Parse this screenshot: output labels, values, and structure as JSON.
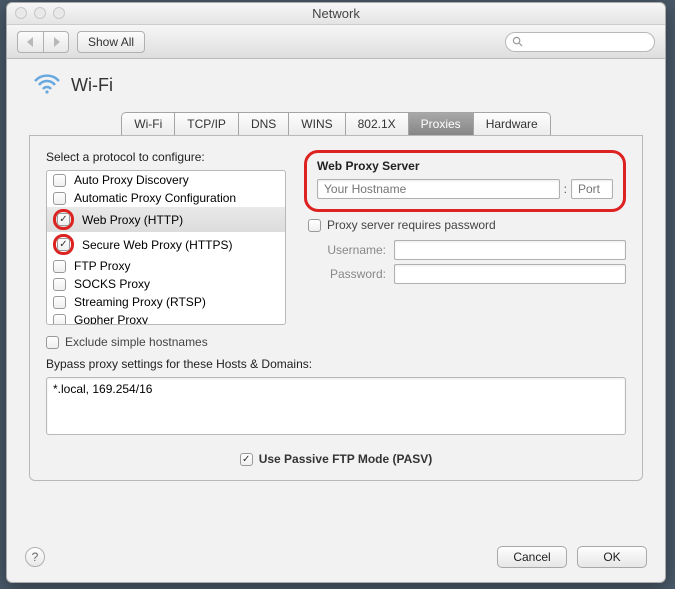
{
  "window": {
    "title": "Network"
  },
  "toolbar": {
    "show_all": "Show All"
  },
  "header": {
    "title": "Wi-Fi"
  },
  "tabs": [
    "Wi-Fi",
    "TCP/IP",
    "DNS",
    "WINS",
    "802.1X",
    "Proxies",
    "Hardware"
  ],
  "active_tab_index": 5,
  "protocol_label": "Select a protocol to configure:",
  "protocols": [
    {
      "label": "Auto Proxy Discovery",
      "checked": false,
      "selected": false
    },
    {
      "label": "Automatic Proxy Configuration",
      "checked": false,
      "selected": false
    },
    {
      "label": "Web Proxy (HTTP)",
      "checked": true,
      "selected": true
    },
    {
      "label": "Secure Web Proxy (HTTPS)",
      "checked": true,
      "selected": false
    },
    {
      "label": "FTP Proxy",
      "checked": false,
      "selected": false
    },
    {
      "label": "SOCKS Proxy",
      "checked": false,
      "selected": false
    },
    {
      "label": "Streaming Proxy (RTSP)",
      "checked": false,
      "selected": false
    },
    {
      "label": "Gopher Proxy",
      "checked": false,
      "selected": false
    }
  ],
  "server": {
    "label": "Web Proxy Server",
    "host_placeholder": "Your Hostname",
    "port_placeholder": "Port"
  },
  "auth": {
    "requires_label": "Proxy server requires password",
    "requires_checked": false,
    "username_label": "Username:",
    "password_label": "Password:"
  },
  "exclude": {
    "label": "Exclude simple hostnames",
    "checked": false
  },
  "bypass": {
    "label": "Bypass proxy settings for these Hosts & Domains:",
    "value": "*.local, 169.254/16"
  },
  "pasv": {
    "label": "Use Passive FTP Mode (PASV)",
    "checked": true
  },
  "buttons": {
    "cancel": "Cancel",
    "ok": "OK"
  }
}
